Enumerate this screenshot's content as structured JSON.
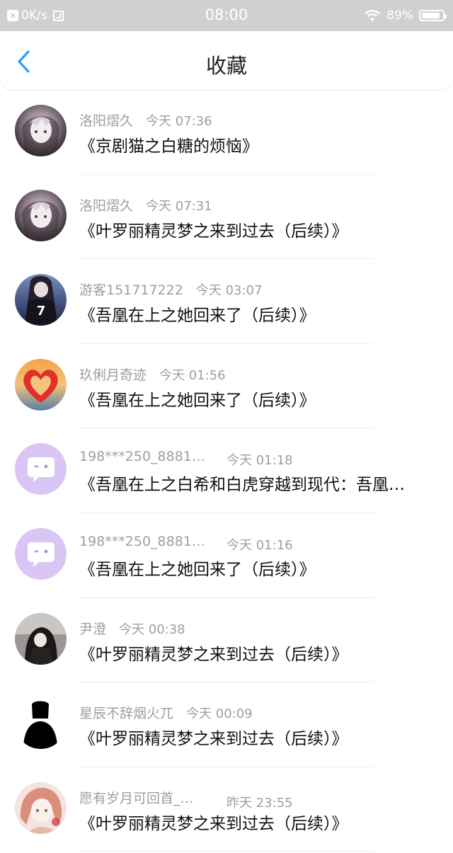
{
  "status": {
    "speed": "0K/s",
    "time": "08:00",
    "battery": "89%",
    "battery_level": 0.89
  },
  "nav": {
    "title": "收藏"
  },
  "items": [
    {
      "name": "洛阳熠久",
      "time": "今天 07:36",
      "title": "《京剧猫之白糖的烦恼》",
      "avatar": "dark-anime-avatar"
    },
    {
      "name": "洛阳熠久",
      "time": "今天 07:31",
      "title": "《叶罗丽精灵梦之来到过去（后续）》",
      "avatar": "dark-anime-avatar"
    },
    {
      "name": "游客151717222",
      "time": "今天 03:07",
      "title": "《吾凰在上之她回来了（后续）》",
      "avatar": "number-seven-avatar"
    },
    {
      "name": "玖俐月奇迹",
      "time": "今天 01:56",
      "title": "《吾凰在上之她回来了（后续）》",
      "avatar": "heart-avatar"
    },
    {
      "name": "198***250_8881…",
      "time": "今天 01:18",
      "title": "《吾凰在上之白希和白虎穿越到现代：吾凰…",
      "avatar": "default-chat-avatar"
    },
    {
      "name": "198***250_8881…",
      "time": "今天 01:16",
      "title": "《吾凰在上之她回来了（后续）》",
      "avatar": "default-chat-avatar"
    },
    {
      "name": "尹澄",
      "time": "今天 00:38",
      "title": "《叶罗丽精灵梦之来到过去（后续）》",
      "avatar": "dark-figure-avatar"
    },
    {
      "name": "星辰不辞烟火兀",
      "time": "今天 00:09",
      "title": "《叶罗丽精灵梦之来到过去（后续）》",
      "avatar": "silhouette-avatar"
    },
    {
      "name": "愿有岁月可回首_…",
      "time": "昨天 23:55",
      "title": "《叶罗丽精灵梦之来到过去（后续）》",
      "avatar": "pink-anime-avatar"
    }
  ]
}
